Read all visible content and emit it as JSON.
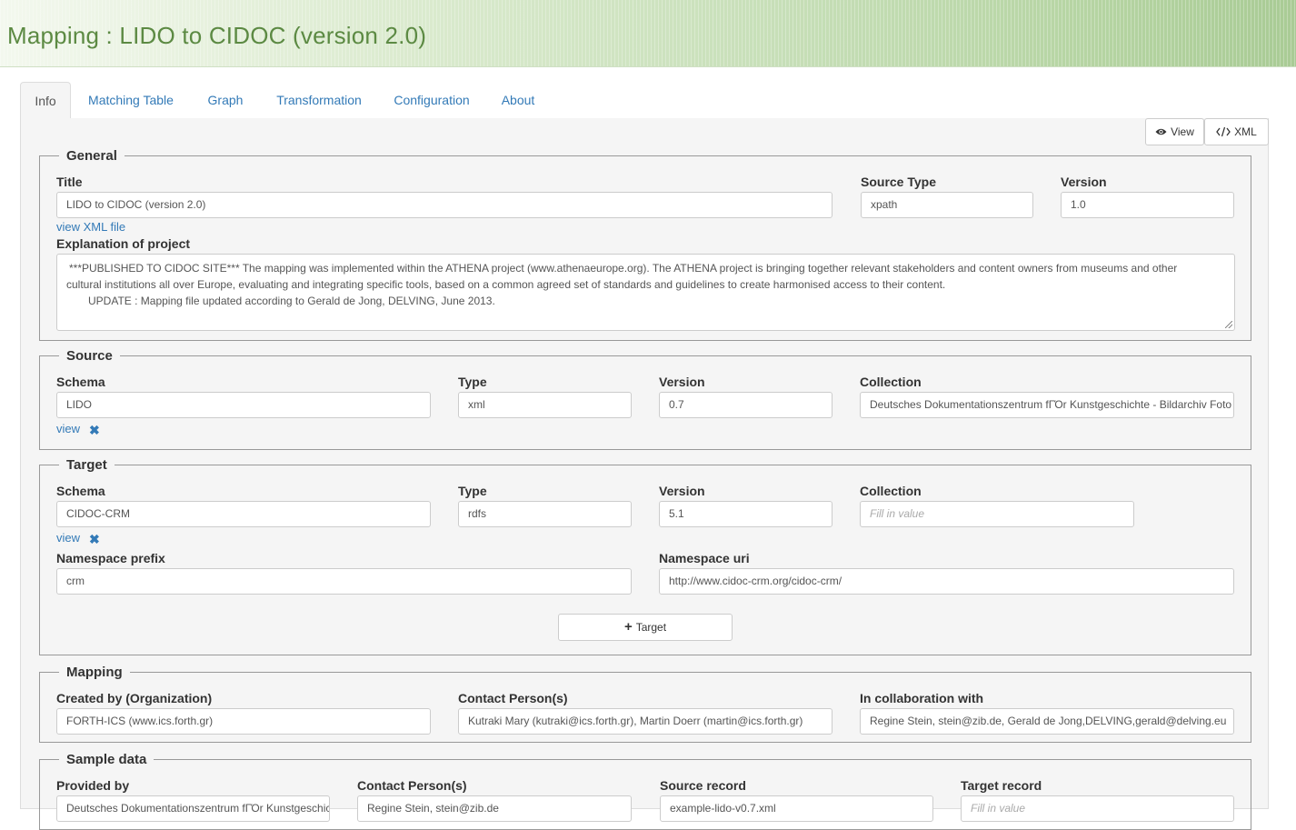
{
  "header": {
    "title": "Mapping : LIDO to CIDOC (version 2.0)"
  },
  "tabs": [
    {
      "label": "Info"
    },
    {
      "label": "Matching Table"
    },
    {
      "label": "Graph"
    },
    {
      "label": "Transformation"
    },
    {
      "label": "Configuration"
    },
    {
      "label": "About"
    }
  ],
  "toolbar": {
    "view_label": "View",
    "xml_label": "XML",
    "view_icon": "eye-icon",
    "xml_icon": "code-icon"
  },
  "general": {
    "legend": "General",
    "title_label": "Title",
    "title_value": "LIDO to CIDOC (version 2.0)",
    "source_type_label": "Source Type",
    "source_type_value": "xpath",
    "version_label": "Version",
    "version_value": "1.0",
    "view_xml_link": "view XML file",
    "explanation_label": "Explanation of project",
    "explanation_line1": "***PUBLISHED TO CIDOC SITE*** The mapping was implemented within the ATHENA project (www.athenaeurope.org). The ATHENA project is bringing together relevant stakeholders and content owners from museums and other",
    "explanation_line2": "cultural institutions all over Europe, evaluating and integrating specific tools, based on a common agreed set of standards and guidelines to create harmonised access to their content.",
    "explanation_line3": "UPDATE : Mapping file updated according to Gerald de Jong, DELVING, June 2013."
  },
  "source": {
    "legend": "Source",
    "schema_label": "Schema",
    "schema_value": "LIDO",
    "type_label": "Type",
    "type_value": "xml",
    "version_label": "Version",
    "version_value": "0.7",
    "collection_label": "Collection",
    "collection_value": "Deutsches Dokumentationszentrum fΓΌr Kunstgeschichte - Bildarchiv Foto Marburg",
    "view_link": "view"
  },
  "target": {
    "legend": "Target",
    "schema_label": "Schema",
    "schema_value": "CIDOC-CRM",
    "type_label": "Type",
    "type_value": "rdfs",
    "version_label": "Version",
    "version_value": "5.1",
    "collection_label": "Collection",
    "collection_placeholder": "Fill in value",
    "view_link": "view",
    "ns_prefix_label": "Namespace prefix",
    "ns_prefix_value": "crm",
    "ns_uri_label": "Namespace uri",
    "ns_uri_value": "http://www.cidoc-crm.org/cidoc-crm/",
    "add_target_label": "Target"
  },
  "mapping": {
    "legend": "Mapping",
    "created_by_label": "Created by (Organization)",
    "created_by_value": "FORTH-ICS (www.ics.forth.gr)",
    "contact_label": "Contact Person(s)",
    "contact_value": "Kutraki Mary (kutraki@ics.forth.gr), Martin Doerr (martin@ics.forth.gr)",
    "collab_label": "In collaboration with",
    "collab_value": "Regine Stein, stein@zib.de, Gerald de Jong,DELVING,gerald@delving.eu"
  },
  "sample": {
    "legend": "Sample data",
    "provided_by_label": "Provided by",
    "provided_by_value": "Deutsches Dokumentationszentrum fΓΌr Kunstgeschichte",
    "contact_label": "Contact Person(s)",
    "contact_value": "Regine Stein, stein@zib.de",
    "source_record_label": "Source record",
    "source_record_value": "example-lido-v0.7.xml",
    "target_record_label": "Target record",
    "target_record_placeholder": "Fill in value"
  }
}
